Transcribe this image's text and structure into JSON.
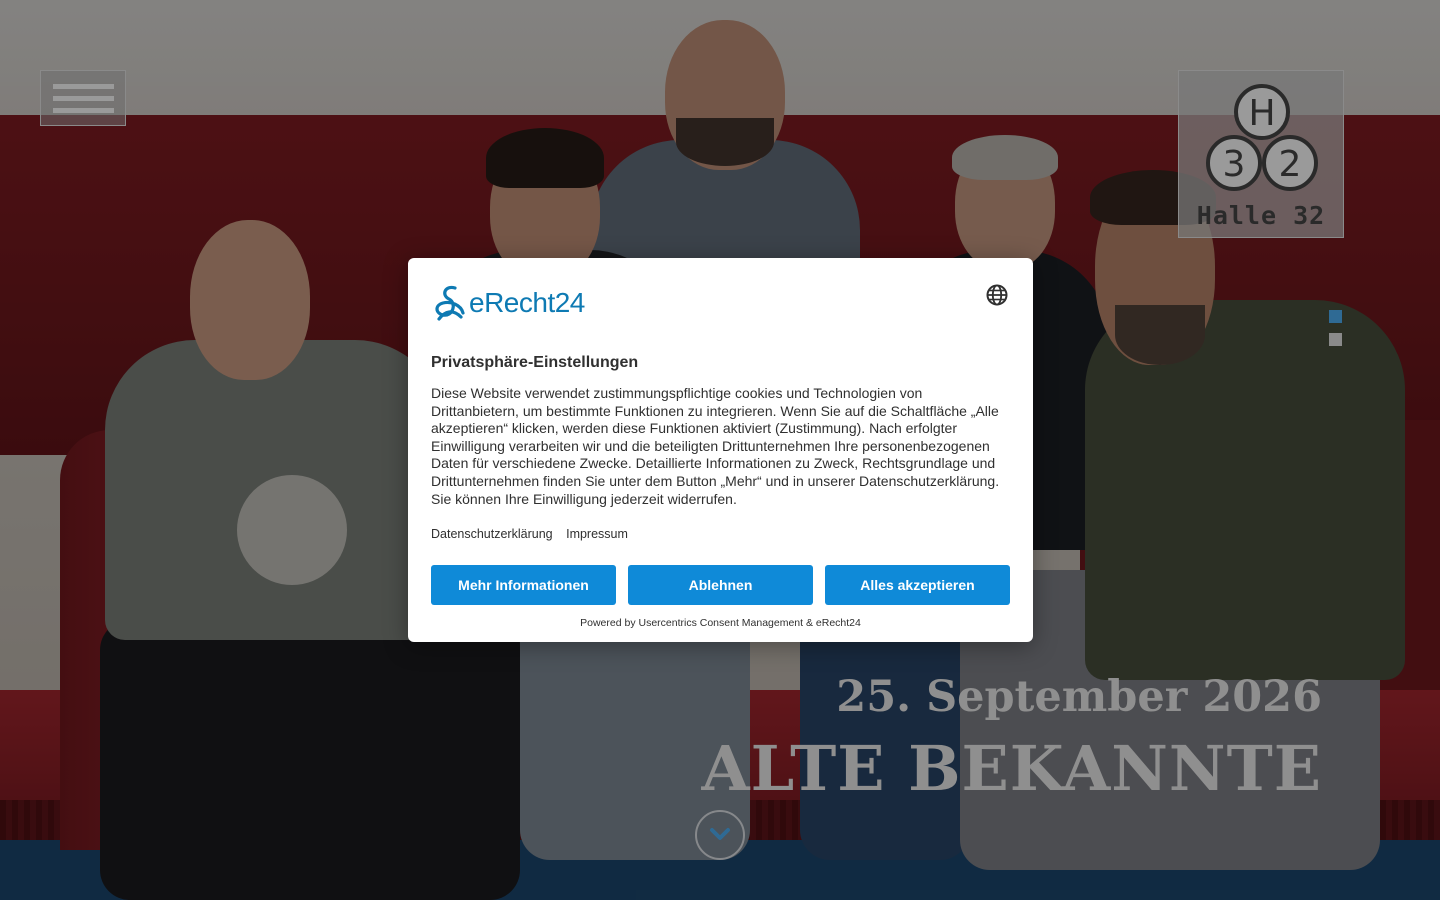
{
  "site": {
    "logo_text": "Halle 32",
    "logo_glyphs": [
      "H",
      "3",
      "2"
    ],
    "event_date": "25. September 2026",
    "event_title": "ALTE BEKANNTE",
    "icons": {
      "menu": "hamburger-menu-icon",
      "scroll": "chevron-down-icon",
      "language": "globe-icon"
    },
    "slider_active_index": 0,
    "slider_count": 2
  },
  "consent": {
    "brand": "eRecht24",
    "title": "Privatsphäre-Einstellungen",
    "body": "Diese Website verwendet zustimmungspflichtige cookies und Technologien von Drittanbietern, um bestimmte Funktionen zu integrieren. Wenn Sie auf die Schaltfläche „Alle akzeptieren“ klicken, werden diese Funktionen aktiviert (Zustimmung). Nach erfolgter Einwilligung verarbeiten wir und die beteiligten Drittunternehmen Ihre personenbezogenen Daten für verschiedene Zwecke. Detaillierte Informationen zu Zweck, Rechtsgrundlage und Drittunternehmen finden Sie unter dem Button „Mehr“ und in unserer Datenschutzerklärung. Sie können Ihre Einwilligung jederzeit widerrufen.",
    "links": {
      "privacy": "Datenschutzerklärung",
      "imprint": "Impressum"
    },
    "buttons": {
      "more": "Mehr Informationen",
      "deny": "Ablehnen",
      "accept_all": "Alles akzeptieren"
    },
    "powered_by": "Powered by Usercentrics Consent Management & eRecht24"
  },
  "colors": {
    "brand_blue": "#0e7ab3",
    "button_blue": "#0f8ad8",
    "slider_active": "#2f6a94"
  }
}
